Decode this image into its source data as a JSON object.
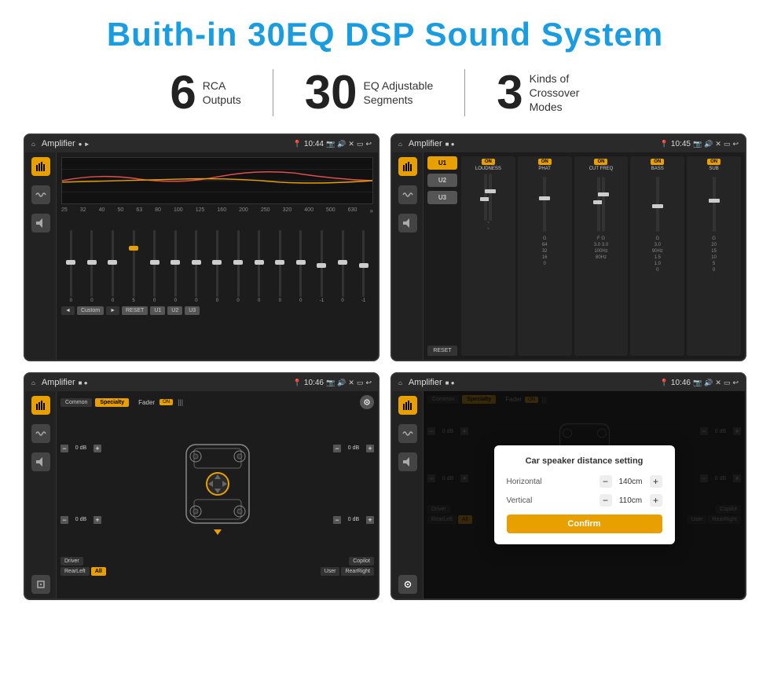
{
  "page": {
    "title": "Buith-in 30EQ DSP Sound System",
    "background": "#ffffff"
  },
  "stats": [
    {
      "number": "6",
      "label_line1": "RCA",
      "label_line2": "Outputs"
    },
    {
      "number": "30",
      "label_line1": "EQ Adjustable",
      "label_line2": "Segments"
    },
    {
      "number": "3",
      "label_line1": "Kinds of",
      "label_line2": "Crossover Modes"
    }
  ],
  "screens": [
    {
      "id": "screen1",
      "title": "Amplifier",
      "time": "10:44",
      "type": "eq",
      "freq_labels": [
        "25",
        "32",
        "40",
        "50",
        "63",
        "80",
        "100",
        "125",
        "160",
        "200",
        "250",
        "320",
        "400",
        "500",
        "630"
      ],
      "slider_values": [
        "0",
        "0",
        "0",
        "5",
        "0",
        "0",
        "0",
        "0",
        "0",
        "0",
        "0",
        "0",
        "-1",
        "0",
        "-1"
      ],
      "bottom_btns": [
        "◄",
        "Custom",
        "►",
        "RESET",
        "U1",
        "U2",
        "U3"
      ]
    },
    {
      "id": "screen2",
      "title": "Amplifier",
      "time": "10:45",
      "type": "mixer",
      "channels": [
        "U1",
        "U2",
        "U3"
      ],
      "controls": [
        {
          "on": true,
          "label": "LOUDNESS"
        },
        {
          "on": true,
          "label": "PHAT"
        },
        {
          "on": true,
          "label": "CUT FREQ"
        },
        {
          "on": true,
          "label": "BASS"
        },
        {
          "on": true,
          "label": "SUB"
        }
      ],
      "reset_label": "RESET"
    },
    {
      "id": "screen3",
      "title": "Amplifier",
      "time": "10:46",
      "type": "speaker",
      "tabs": [
        "Common",
        "Specialty"
      ],
      "fader_label": "Fader",
      "fader_on": "ON",
      "db_values": [
        "0 dB",
        "0 dB",
        "0 dB",
        "0 dB"
      ],
      "bottom_btns": [
        "Driver",
        "Copilot",
        "RearLeft",
        "All",
        "User",
        "RearRight"
      ]
    },
    {
      "id": "screen4",
      "title": "Amplifier",
      "time": "10:46",
      "type": "dialog",
      "dialog_title": "Car speaker distance setting",
      "fields": [
        {
          "label": "Horizontal",
          "value": "140cm"
        },
        {
          "label": "Vertical",
          "value": "110cm"
        }
      ],
      "confirm_label": "Confirm",
      "tabs": [
        "Common",
        "Specialty"
      ],
      "db_values": [
        "0 dB",
        "0 dB"
      ],
      "bottom_btns": [
        "Driver",
        "Copilot",
        "RearLeft",
        "User",
        "RearRight"
      ]
    }
  ]
}
